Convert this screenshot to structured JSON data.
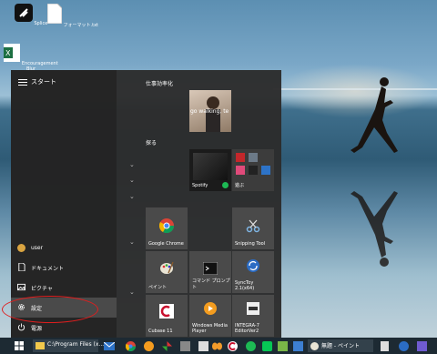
{
  "desktop": {
    "icons": [
      {
        "label": "Splice",
        "icon": "splice-app-icon"
      },
      {
        "label": "フォーマット.txt",
        "icon": "text-file-icon"
      },
      {
        "label": "Encouragement Blur",
        "icon": "excel-file-icon"
      }
    ]
  },
  "start_menu": {
    "title": "スタート",
    "left_items": [
      {
        "label": "user",
        "icon": "user-avatar-icon"
      },
      {
        "label": "ドキュメント",
        "icon": "document-icon"
      },
      {
        "label": "ピクチャ",
        "icon": "picture-icon"
      },
      {
        "label": "設定",
        "icon": "gear-icon"
      },
      {
        "label": "電源",
        "icon": "power-icon"
      }
    ],
    "groups": [
      {
        "label": "仕事効率化"
      },
      {
        "label": "探る"
      }
    ],
    "tiles": {
      "video_text": "go walking, te",
      "spotify": "Spotify",
      "play": "遊ぶ",
      "chrome": "Google Chrome",
      "snipping": "Snipping Tool",
      "paint": "ペイント",
      "cmd": "コマンド プロンプト",
      "synctoy": "SyncToy 2.1(x64)",
      "cubase": "Cubase 11",
      "wmp": "Windows Media Player",
      "integra": "INTEGRA-7 EditorVer2"
    }
  },
  "taskbar": {
    "explorer_label": "C:\\Program Files (x...",
    "paint_label": "無題 - ペイント"
  },
  "colors": {
    "start_bg": "#2c2c2c",
    "tile_bg": "#4a4a4a",
    "annotation": "#e01e1e",
    "taskbar_bg": "#1d2a33"
  }
}
